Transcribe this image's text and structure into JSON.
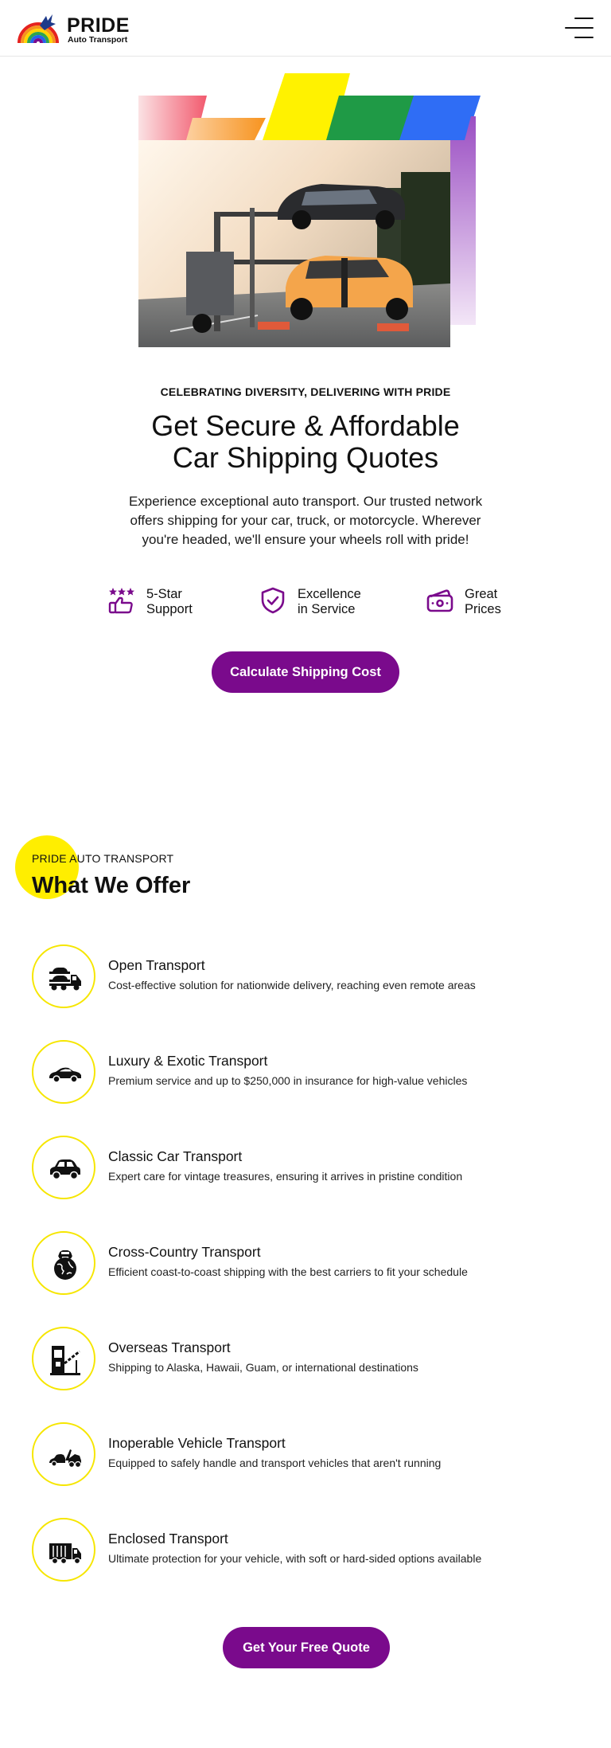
{
  "header": {
    "brand_name": "PRIDE",
    "brand_sub": "Auto Transport",
    "menu_icon": "hamburger-icon"
  },
  "hero": {
    "eyebrow": "CELEBRATING DIVERSITY, DELIVERING WITH PRIDE",
    "title_line1": "Get Secure & Affordable",
    "title_line2": "Car Shipping Quotes",
    "description": "Experience exceptional auto transport. Our trusted network offers shipping for your car, truck, or motorcycle. Wherever you're headed, we'll ensure your wheels roll with pride!",
    "features": [
      {
        "icon": "thumbs-up-stars-icon",
        "line1": "5-Star",
        "line2": "Support"
      },
      {
        "icon": "shield-check-icon",
        "line1": "Excellence",
        "line2": "in Service"
      },
      {
        "icon": "wallet-cash-icon",
        "line1": "Great",
        "line2": "Prices"
      }
    ],
    "cta": "Calculate Shipping Cost"
  },
  "offer": {
    "eyebrow": "PRIDE AUTO TRANSPORT",
    "title": "What We Offer",
    "services": [
      {
        "icon": "car-carrier-truck-icon",
        "title": "Open Transport",
        "desc": "Cost-effective solution for nationwide delivery, reaching even remote areas"
      },
      {
        "icon": "sports-car-icon",
        "title": "Luxury & Exotic Transport",
        "desc": "Premium service and up to $250,000 in insurance for high-value vehicles"
      },
      {
        "icon": "classic-car-icon",
        "title": "Classic Car Transport",
        "desc": "Expert care for vintage treasures, ensuring it arrives in pristine condition"
      },
      {
        "icon": "globe-car-icon",
        "title": "Cross-Country Transport",
        "desc": "Efficient coast-to-coast shipping with the best carriers to fit your schedule"
      },
      {
        "icon": "toll-gate-icon",
        "title": "Overseas Transport",
        "desc": "Shipping to Alaska, Hawaii, Guam, or international destinations"
      },
      {
        "icon": "tow-truck-icon",
        "title": "Inoperable Vehicle Transport",
        "desc": "Equipped to safely handle and transport vehicles that aren't running"
      },
      {
        "icon": "enclosed-trailer-icon",
        "title": "Enclosed Transport",
        "desc": "Ultimate protection for your vehicle, with soft or hard-sided options available"
      }
    ],
    "cta": "Get Your Free Quote"
  },
  "colors": {
    "accent_purple": "#7a0a8c",
    "highlight_yellow": "#ffee00",
    "circle_border": "#f6e600"
  }
}
